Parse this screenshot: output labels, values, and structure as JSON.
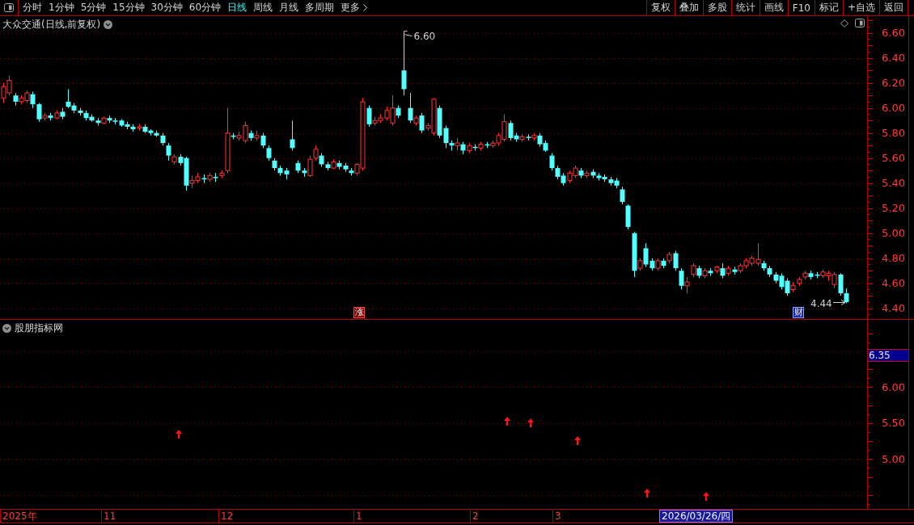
{
  "toolbar": {
    "periods": [
      {
        "label": "分时",
        "selected": false
      },
      {
        "label": "1分钟",
        "selected": false
      },
      {
        "label": "5分钟",
        "selected": false
      },
      {
        "label": "15分钟",
        "selected": false
      },
      {
        "label": "30分钟",
        "selected": false
      },
      {
        "label": "60分钟",
        "selected": false
      },
      {
        "label": "日线",
        "selected": true
      },
      {
        "label": "周线",
        "selected": false
      },
      {
        "label": "月线",
        "selected": false
      },
      {
        "label": "多周期",
        "selected": false
      }
    ],
    "more": "更多",
    "buttons": [
      "复权",
      "叠加",
      "多股",
      "统计",
      "画线",
      "F10",
      "标记",
      "+自选",
      "返回"
    ]
  },
  "price_chart": {
    "title": "大众交通(日线,前复权)",
    "axis_labels": [
      "6.60",
      "6.40",
      "6.20",
      "6.00",
      "5.80",
      "5.60",
      "5.40",
      "5.20",
      "5.00",
      "4.80",
      "4.60",
      "4.40"
    ],
    "high_label": "6.60",
    "low_label": "4.44",
    "markers": [
      {
        "text": "涨",
        "kind": "rise"
      },
      {
        "text": "财",
        "kind": "finance"
      }
    ]
  },
  "indicator_panel": {
    "title": "股朋指标网",
    "current_value": "6.35",
    "axis_labels": [
      "6.00",
      "5.50",
      "5.00"
    ]
  },
  "time_axis": {
    "labels": [
      "2025年",
      "11",
      "12",
      "1",
      "2",
      "3"
    ],
    "cursor_date": "2026/03/26/四"
  }
}
